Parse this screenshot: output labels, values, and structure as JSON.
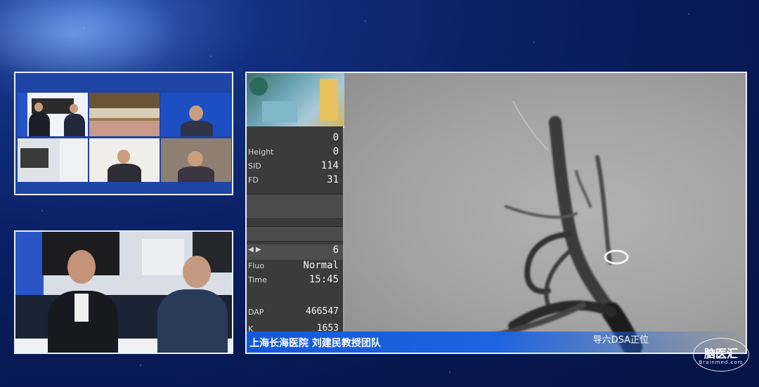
{
  "dsa": {
    "readout_rows": [
      {
        "label": "",
        "value": "0"
      },
      {
        "label": "Height",
        "value": "0"
      },
      {
        "label": "SID",
        "value": "114"
      },
      {
        "label": "FD",
        "value": "31"
      }
    ],
    "lower_rows": [
      {
        "label": "",
        "value": "6"
      },
      {
        "label": "Fluo",
        "value": "Normal"
      },
      {
        "label": "Time",
        "value": "15:45"
      }
    ],
    "dap_label": "DAP",
    "dap_value": "466547",
    "k_label": "K",
    "k_value": "1653",
    "caption": "上海长海医院  刘建民教授团队",
    "position_label": "导六DSA正位"
  },
  "logo": {
    "cn": "脑医汇",
    "en": "Brainmed.com"
  },
  "colors": {
    "background": "#0a1f63",
    "caption_bar": "#1458d8",
    "readout_bg": "#3b3b3b"
  }
}
